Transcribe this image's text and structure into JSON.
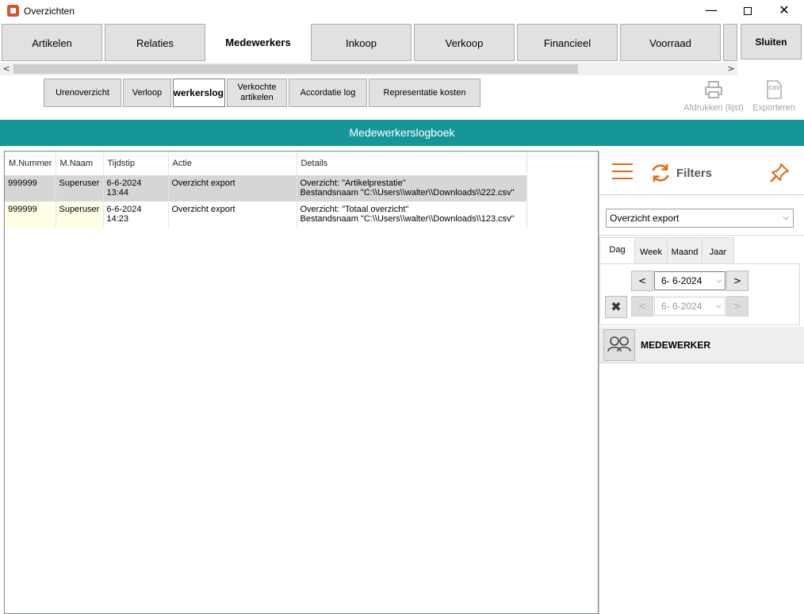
{
  "window": {
    "title": "Overzichten",
    "controls": {
      "minimize": "—",
      "maximize": "",
      "close": "✕"
    }
  },
  "main_tabs": [
    {
      "label": "Artikelen"
    },
    {
      "label": "Relaties"
    },
    {
      "label": "Medewerkers",
      "active": true
    },
    {
      "label": "Inkoop"
    },
    {
      "label": "Verkoop"
    },
    {
      "label": "Financieel"
    },
    {
      "label": "Voorraad"
    }
  ],
  "close_button": "Sluiten",
  "scroll": {
    "left": "<",
    "right": ">"
  },
  "sub_tabs": [
    {
      "label": "Urenoverzicht"
    },
    {
      "label": "Verloop"
    },
    {
      "label": "Medewerkerslog",
      "active": true
    },
    {
      "label": "Verkochte artikelen"
    },
    {
      "label": "Accordatie log"
    },
    {
      "label": "Representatie kosten"
    }
  ],
  "toolbar": {
    "print_label": "Afdrukken (lijst)",
    "export_label": "Exporteren",
    "export_icon_text": "CSV"
  },
  "section_title": "Medewerkerslogboek",
  "table": {
    "columns": [
      "M.Nummer",
      "M.Naam",
      "Tijdstip",
      "Actie",
      "Details"
    ],
    "rows": [
      {
        "nummer": "999999",
        "naam": "Superuser",
        "tijdstip": "6-6-2024 13:44",
        "actie": "Overzicht export",
        "details_1": "Overzicht: \"Artikelprestatie\"",
        "details_2": "Bestandsnaam \"C:\\\\Users\\\\walter\\\\Downloads\\\\222.csv\""
      },
      {
        "nummer": "999999",
        "naam": "Superuser",
        "tijdstip": "6-6-2024 14:23",
        "actie": "Overzicht export",
        "details_1": "Overzicht: \"Totaal overzicht\"",
        "details_2": "Bestandsnaam \"C:\\\\Users\\\\walter\\\\Downloads\\\\123.csv\""
      }
    ]
  },
  "filters": {
    "label": "Filters",
    "action_select": "Overzicht export",
    "period_tabs": [
      "Dag",
      "Week",
      "Maand",
      "Jaar"
    ],
    "date_from": "6-  6-2024",
    "date_to": "6-  6-2024",
    "prev": "<",
    "next": ">",
    "clear": "✖",
    "employee_label": "MEDEWERKER"
  },
  "colors": {
    "accent": "#17969a",
    "orange": "#e06a1b",
    "selected_row": "#d6d6d6"
  }
}
